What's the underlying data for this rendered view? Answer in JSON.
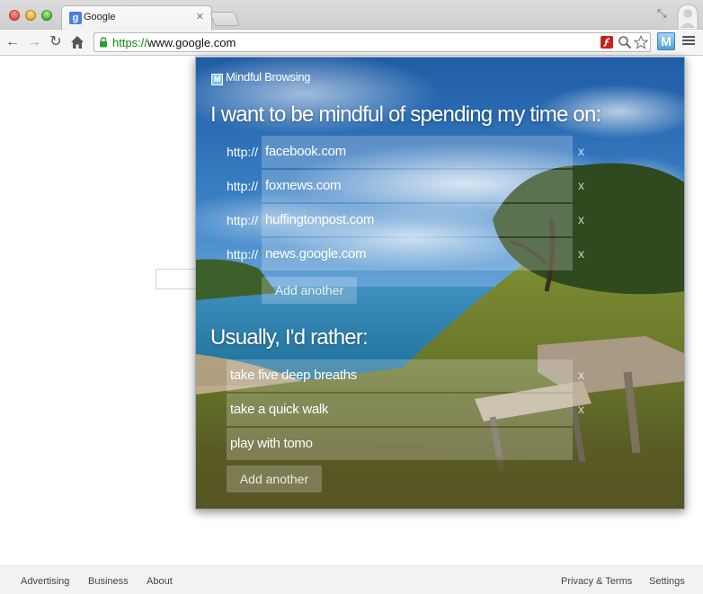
{
  "browser": {
    "tab_title": "Google",
    "tab_favicon": "g-icon",
    "url_scheme": "https://",
    "url_rest": "www.google.com",
    "close_glyph": "✕"
  },
  "popup": {
    "brand": "Mindful Browsing",
    "heading_sites": "I want to be mindful of spending my time on:",
    "proto": "http://",
    "sites": [
      "facebook.com",
      "foxnews.com",
      "huffingtonpost.com",
      "news.google.com"
    ],
    "add_site": "Add another",
    "heading_alts": "Usually, I'd rather:",
    "alternatives": [
      "take five deep breaths",
      "take a quick walk",
      "play with tomo"
    ],
    "add_alt": "Add another",
    "remove": "x"
  },
  "footer": {
    "left": [
      "Advertising",
      "Business",
      "About"
    ],
    "right": [
      "Privacy & Terms",
      "Settings"
    ]
  },
  "colors": {
    "url_scheme": "#0a8a0a",
    "extension_accent": "#4ea3dc"
  }
}
